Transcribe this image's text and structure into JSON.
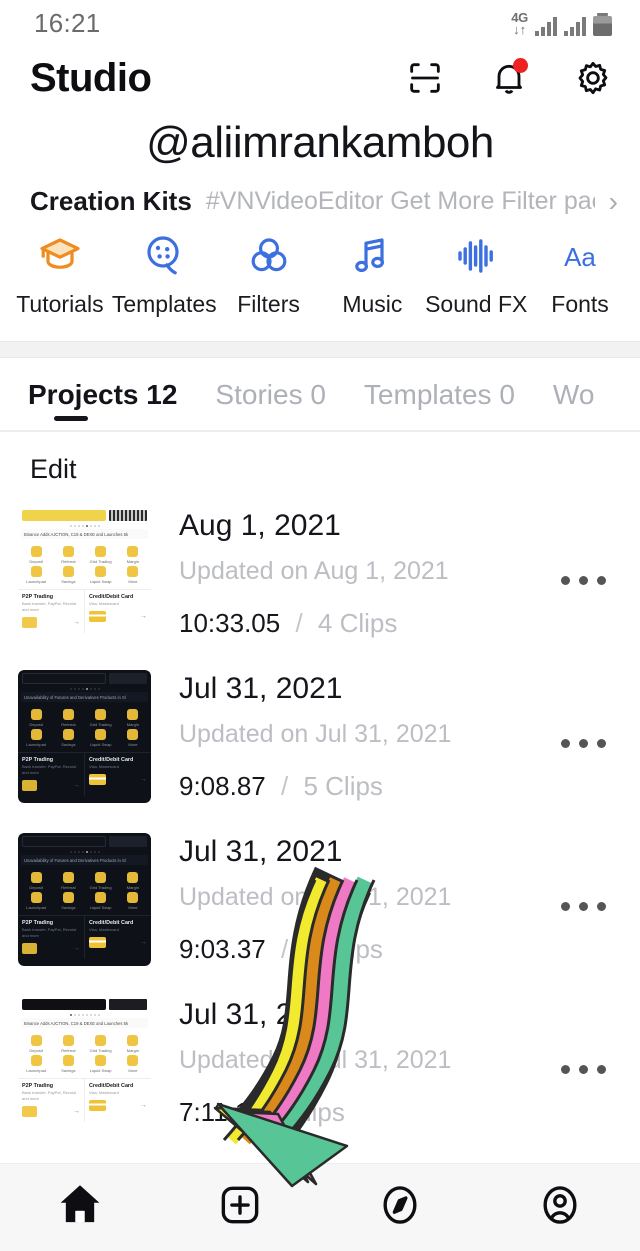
{
  "status_bar": {
    "time": "16:21",
    "network": "4G",
    "network_arrows": "↓↑",
    "signal_icon": "signal-bars-icon",
    "battery_icon": "battery-icon"
  },
  "header": {
    "title": "Studio",
    "scan_icon": "scan-frame-icon",
    "bell_icon": "notification-bell-icon",
    "bell_has_badge": true,
    "settings_icon": "gear-icon"
  },
  "profile": {
    "username": "@aliimrankamboh"
  },
  "creation_kits": {
    "title": "Creation Kits",
    "promo": "#VNVideoEditor Get More Filter package",
    "chevron": "›",
    "items": [
      {
        "label": "Tutorials",
        "icon": "graduation-cap-icon",
        "color": "#ef8b1f"
      },
      {
        "label": "Templates",
        "icon": "film-reel-icon",
        "color": "#3c6fe0"
      },
      {
        "label": "Filters",
        "icon": "three-circles-icon",
        "color": "#3c6fe0"
      },
      {
        "label": "Music",
        "icon": "music-note-icon",
        "color": "#3c6fe0"
      },
      {
        "label": "Sound FX",
        "icon": "waveform-icon",
        "color": "#3c6fe0"
      },
      {
        "label": "Fonts",
        "icon": "font-aa-icon",
        "color": "#3c6fe0"
      }
    ]
  },
  "tabs": [
    {
      "label": "Projects 12",
      "active": true
    },
    {
      "label": "Stories 0",
      "active": false
    },
    {
      "label": "Templates 0",
      "active": false
    },
    {
      "label": "Wo",
      "active": false
    }
  ],
  "section": {
    "title": "Edit"
  },
  "projects": [
    {
      "date": "Aug 1, 2021",
      "updated": "Updated on Aug 1, 2021",
      "duration": "10:33.05",
      "separator": "/",
      "clips": "4 Clips",
      "more_icon": "more-options-icon",
      "theme": "light",
      "thumb": {
        "notice": "Binance Adds AJCTION, C19 & DEXE and Launches 5k",
        "tiles": [
          "Deposit",
          "Referral",
          "Grid Trading",
          "Margin"
        ],
        "tiles2": [
          "Launchpad",
          "Savings",
          "Liquid Swap",
          "More"
        ],
        "left_title": "P2P Trading",
        "left_sub": "Bank transfer, PayPal, Revolut and more",
        "right_title": "Credit/Debit Card",
        "right_sub": "Visa, Mastercard"
      }
    },
    {
      "date": "Jul 31, 2021",
      "updated": "Updated on Jul 31, 2021",
      "duration": "9:08.87",
      "separator": "/",
      "clips": "5 Clips",
      "more_icon": "more-options-icon",
      "theme": "dark",
      "thumb": {
        "notice": "Unavailability of Futures and Derivatives Products in Sl",
        "tiles": [
          "Deposit",
          "Referral",
          "Grid Trading",
          "Margin"
        ],
        "tiles2": [
          "Launchpad",
          "Savings",
          "Liquid Swap",
          "More"
        ],
        "left_title": "P2P Trading",
        "left_sub": "Bank transfer, PayPal, Revolut and more",
        "right_title": "Credit/Debit Card",
        "right_sub": "Visa, Mastercard"
      }
    },
    {
      "date": "Jul 31, 2021",
      "updated": "Updated on Jul 31, 2021",
      "duration": "9:03.37",
      "separator": "/",
      "clips": "6 Clips",
      "more_icon": "more-options-icon",
      "theme": "dark",
      "thumb": {
        "notice": "Unavailability of Futures and Derivatives Products in Sl",
        "tiles": [
          "Deposit",
          "Referral",
          "Grid Trading",
          "Margin"
        ],
        "tiles2": [
          "Launchpad",
          "Savings",
          "Liquid Swap",
          "More"
        ],
        "left_title": "P2P Trading",
        "left_sub": "Bank transfer, PayPal, Revolut and more",
        "right_title": "Credit/Debit Card",
        "right_sub": "Visa, Mastercard"
      }
    },
    {
      "date": "Jul 31, 20",
      "updated": "Updated on Jul 31, 2021",
      "duration": "7:11.1",
      "separator": "/",
      "clips": "Clips",
      "more_icon": "more-options-icon",
      "theme": "light",
      "thumb": {
        "notice": "Binance Adds AJCTION, C19 & DEXE and Launches 5k",
        "tiles": [
          "Deposit",
          "Referral",
          "Grid Trading",
          "Margin"
        ],
        "tiles2": [
          "Launchpad",
          "Savings",
          "Liquid Swap",
          "More"
        ],
        "left_title": "P2P Trading",
        "left_sub": "Bank transfer, PayPal, Revolut and more",
        "right_title": "Credit/Debit Card",
        "right_sub": "Visa, Mastercard"
      }
    }
  ],
  "bottom_nav": [
    {
      "icon": "home-icon",
      "active": true
    },
    {
      "icon": "plus-square-icon",
      "active": false
    },
    {
      "icon": "compass-icon",
      "active": false
    },
    {
      "icon": "account-circle-icon",
      "active": false
    }
  ],
  "annotation_arrow": {
    "icon": "curved-striped-arrow-annotation",
    "stripe_colors": [
      "#f2ea2e",
      "#d98a1b",
      "#ef79c4",
      "#57c595"
    ],
    "outline_color": "#2a2a2a"
  },
  "colors": {
    "accent_blue": "#3c6fe0",
    "accent_orange": "#ef8b1f",
    "badge_red": "#ee2222",
    "text_primary": "#15151c",
    "text_muted": "#bcbec4",
    "bottom_bar_bg": "#f7f7f7"
  }
}
